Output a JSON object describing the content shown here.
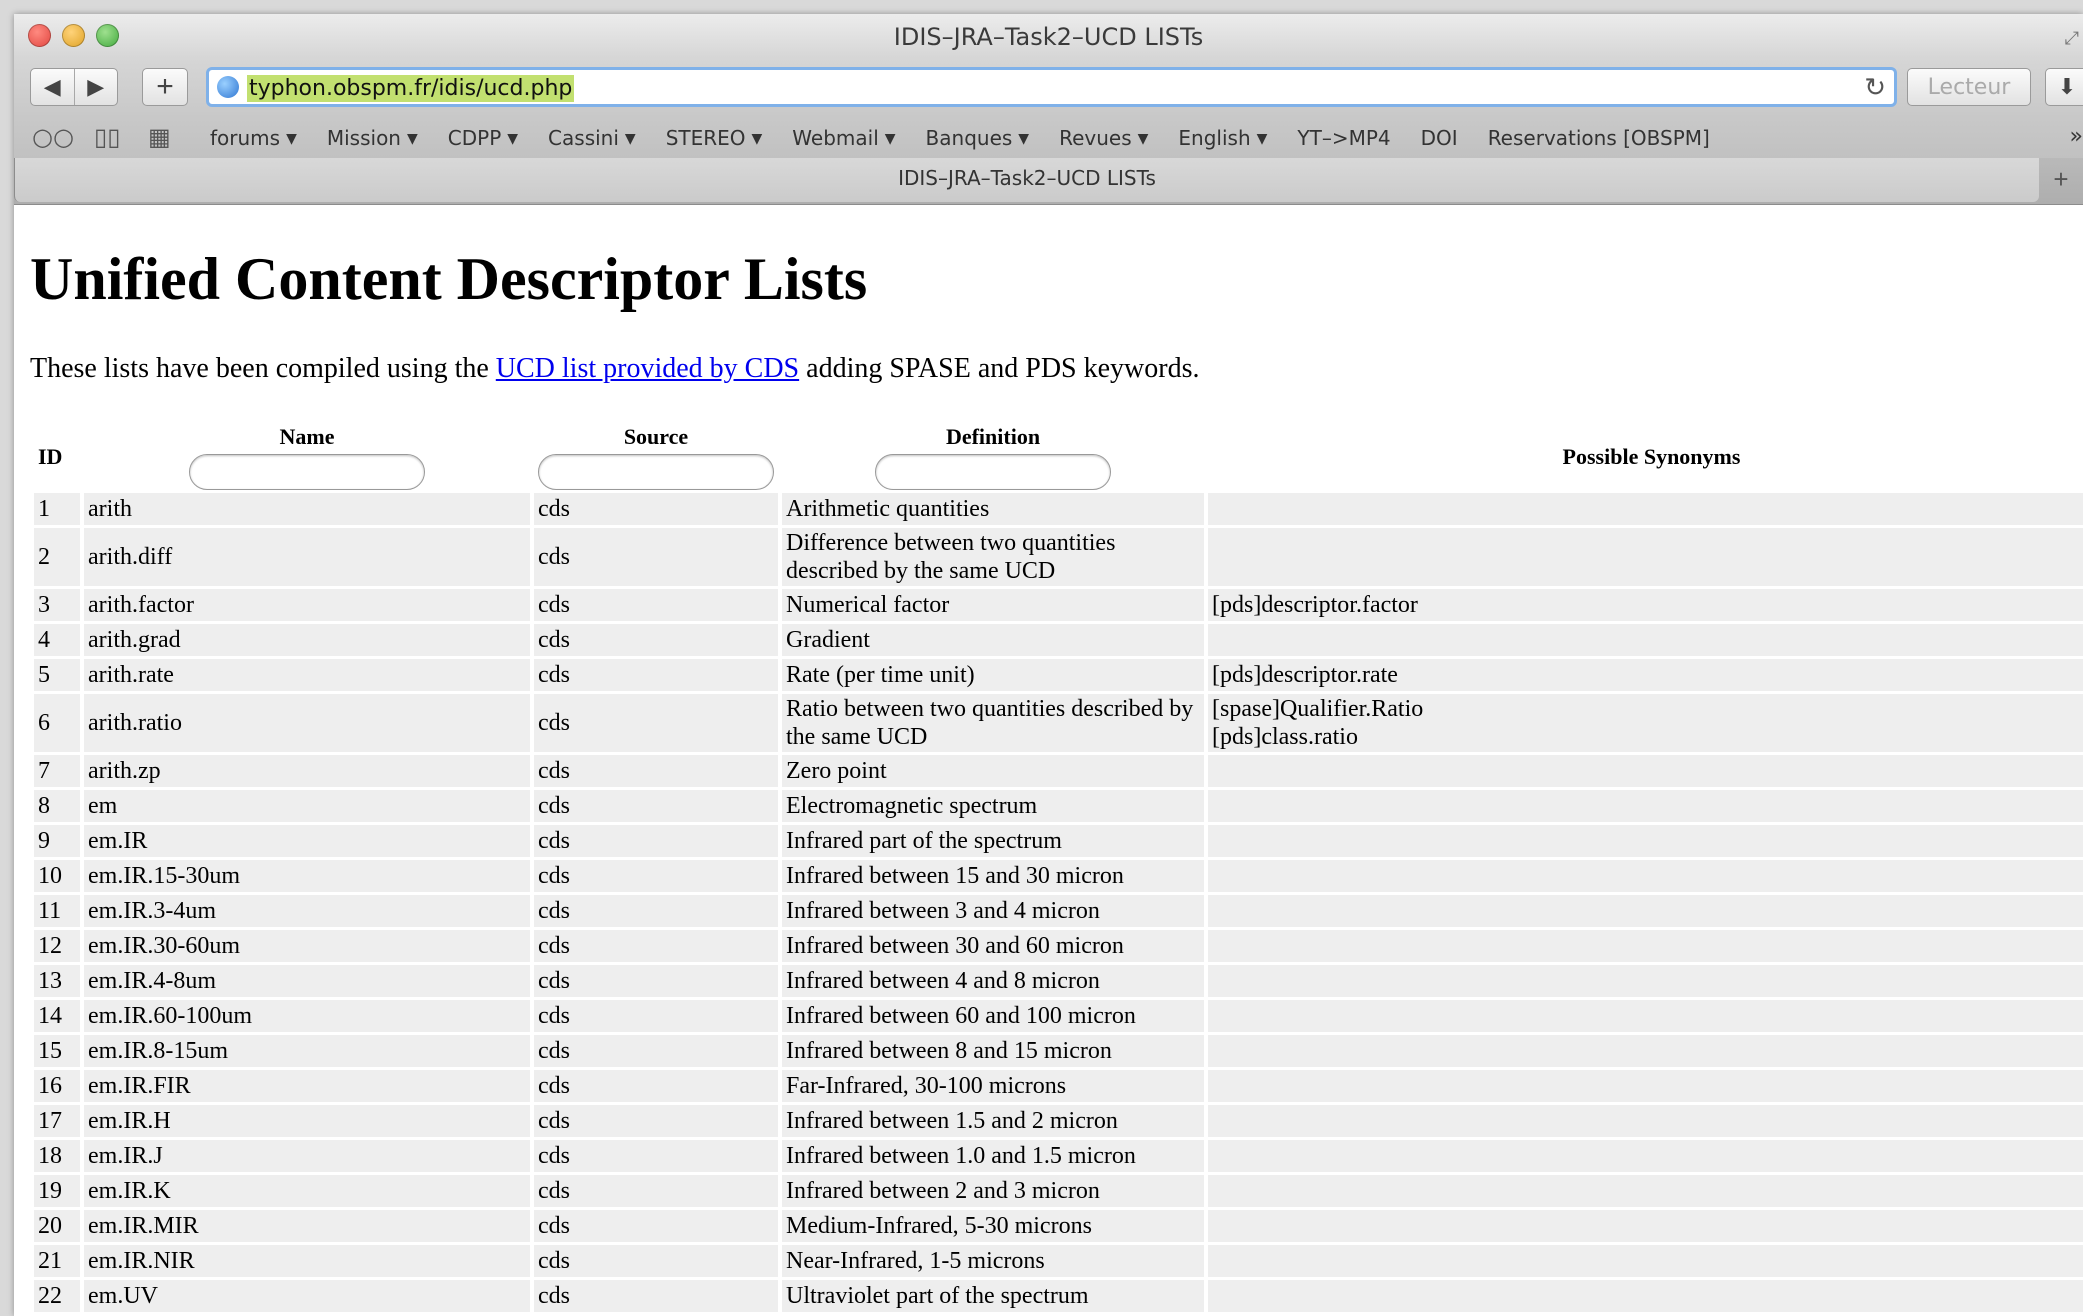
{
  "window": {
    "title": "IDIS–JRA–Task2–UCD LISTs"
  },
  "toolbar": {
    "url": "typhon.obspm.fr/idis/ucd.php",
    "reader_label": "Lecteur"
  },
  "bookmarks": [
    {
      "label": "forums",
      "menu": true
    },
    {
      "label": "Mission",
      "menu": true
    },
    {
      "label": "CDPP",
      "menu": true
    },
    {
      "label": "Cassini",
      "menu": true
    },
    {
      "label": "STEREO",
      "menu": true
    },
    {
      "label": "Webmail",
      "menu": true
    },
    {
      "label": "Banques",
      "menu": true
    },
    {
      "label": "Revues",
      "menu": true
    },
    {
      "label": "English",
      "menu": true
    },
    {
      "label": "YT–>MP4",
      "menu": false
    },
    {
      "label": "DOI",
      "menu": false
    },
    {
      "label": "Reservations [OBSPM]",
      "menu": false
    }
  ],
  "tab": {
    "title": "IDIS–JRA–Task2–UCD LISTs"
  },
  "page": {
    "title": "Unified Content Descriptor Lists",
    "intro_before": "These lists have been compiled using the ",
    "intro_link": "UCD list provided by CDS",
    "intro_after": " adding SPASE and PDS keywords."
  },
  "table": {
    "headers": {
      "id": "ID",
      "name": "Name",
      "source": "Source",
      "definition": "Definition",
      "synonyms": "Possible Synonyms"
    },
    "rows": [
      {
        "id": "1",
        "name": "arith",
        "source": "cds",
        "definition": "Arithmetic quantities",
        "synonyms": []
      },
      {
        "id": "2",
        "name": "arith.diff",
        "source": "cds",
        "definition": "Difference between two quantities described by the same UCD",
        "synonyms": []
      },
      {
        "id": "3",
        "name": "arith.factor",
        "source": "cds",
        "definition": "Numerical factor",
        "synonyms": [
          "[pds]descriptor.factor"
        ]
      },
      {
        "id": "4",
        "name": "arith.grad",
        "source": "cds",
        "definition": "Gradient",
        "synonyms": []
      },
      {
        "id": "5",
        "name": "arith.rate",
        "source": "cds",
        "definition": "Rate (per time unit)",
        "synonyms": [
          "[pds]descriptor.rate"
        ]
      },
      {
        "id": "6",
        "name": "arith.ratio",
        "source": "cds",
        "definition": "Ratio between two quantities described by the same UCD",
        "synonyms": [
          "[spase]Qualifier.Ratio",
          "[pds]class.ratio"
        ]
      },
      {
        "id": "7",
        "name": "arith.zp",
        "source": "cds",
        "definition": "Zero point",
        "synonyms": []
      },
      {
        "id": "8",
        "name": "em",
        "source": "cds",
        "definition": "Electromagnetic spectrum",
        "synonyms": []
      },
      {
        "id": "9",
        "name": "em.IR",
        "source": "cds",
        "definition": "Infrared part of the spectrum",
        "synonyms": []
      },
      {
        "id": "10",
        "name": "em.IR.15-30um",
        "source": "cds",
        "definition": "Infrared between 15 and 30 micron",
        "synonyms": []
      },
      {
        "id": "11",
        "name": "em.IR.3-4um",
        "source": "cds",
        "definition": "Infrared between 3 and 4 micron",
        "synonyms": []
      },
      {
        "id": "12",
        "name": "em.IR.30-60um",
        "source": "cds",
        "definition": "Infrared between 30 and 60 micron",
        "synonyms": []
      },
      {
        "id": "13",
        "name": "em.IR.4-8um",
        "source": "cds",
        "definition": "Infrared between 4 and 8 micron",
        "synonyms": []
      },
      {
        "id": "14",
        "name": "em.IR.60-100um",
        "source": "cds",
        "definition": "Infrared between 60 and 100 micron",
        "synonyms": []
      },
      {
        "id": "15",
        "name": "em.IR.8-15um",
        "source": "cds",
        "definition": "Infrared between 8 and 15 micron",
        "synonyms": []
      },
      {
        "id": "16",
        "name": "em.IR.FIR",
        "source": "cds",
        "definition": "Far-Infrared, 30-100 microns",
        "synonyms": []
      },
      {
        "id": "17",
        "name": "em.IR.H",
        "source": "cds",
        "definition": "Infrared between 1.5 and 2 micron",
        "synonyms": []
      },
      {
        "id": "18",
        "name": "em.IR.J",
        "source": "cds",
        "definition": "Infrared between 1.0 and 1.5 micron",
        "synonyms": []
      },
      {
        "id": "19",
        "name": "em.IR.K",
        "source": "cds",
        "definition": "Infrared between 2 and 3 micron",
        "synonyms": []
      },
      {
        "id": "20",
        "name": "em.IR.MIR",
        "source": "cds",
        "definition": "Medium-Infrared, 5-30 microns",
        "synonyms": []
      },
      {
        "id": "21",
        "name": "em.IR.NIR",
        "source": "cds",
        "definition": "Near-Infrared, 1-5 microns",
        "synonyms": []
      },
      {
        "id": "22",
        "name": "em.UV",
        "source": "cds",
        "definition": "Ultraviolet part of the spectrum",
        "synonyms": []
      }
    ]
  }
}
